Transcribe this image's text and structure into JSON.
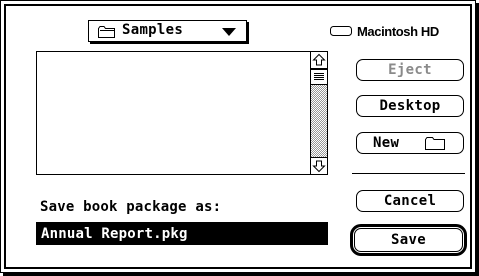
{
  "popup": {
    "folder_name": "Samples",
    "icon": "folder-icon"
  },
  "volume": {
    "name": "Macintosh HD",
    "icon": "hard-drive-icon"
  },
  "file_list": {
    "items": []
  },
  "buttons": {
    "eject": "Eject",
    "desktop": "Desktop",
    "new": "New",
    "cancel": "Cancel",
    "save": "Save"
  },
  "save_prompt": "Save book package as:",
  "filename": "Annual Report.pkg",
  "colors": {
    "text": "#000000",
    "background": "#ffffff",
    "disabled_text": "#8a8a8a",
    "selection": "#000000"
  }
}
